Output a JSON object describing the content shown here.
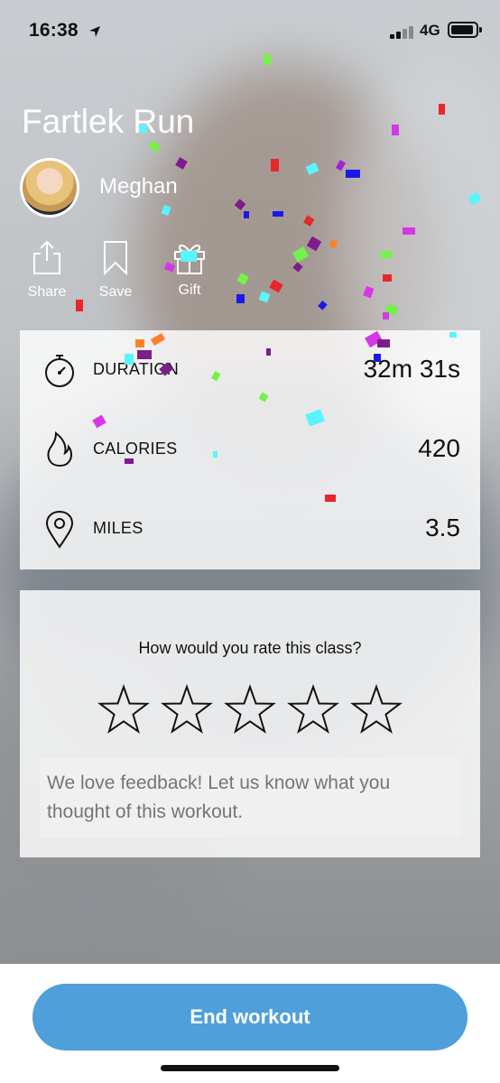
{
  "status_bar": {
    "time": "16:38",
    "network": "4G"
  },
  "workout": {
    "title": "Fartlek Run",
    "instructor": "Meghan"
  },
  "actions": [
    {
      "label": "Share",
      "icon": "share-icon"
    },
    {
      "label": "Save",
      "icon": "bookmark-icon"
    },
    {
      "label": "Gift",
      "icon": "gift-icon"
    }
  ],
  "stats": [
    {
      "label": "DURATION",
      "value": "32m 31s",
      "icon": "stopwatch-icon"
    },
    {
      "label": "CALORIES",
      "value": "420",
      "icon": "flame-icon"
    },
    {
      "label": "MILES",
      "value": "3.5",
      "icon": "location-pin-icon"
    }
  ],
  "rating": {
    "question": "How would you rate this class?",
    "max_stars": 5,
    "selected": 0,
    "feedback_placeholder": "We love feedback! Let us know what you thought of this workout."
  },
  "end_button": {
    "label": "End workout"
  },
  "colors": {
    "accent": "#4f9fda",
    "confetti": [
      "#e8262b",
      "#7f1c8c",
      "#58f5ff",
      "#74f24a",
      "#d638e6",
      "#1a1ae6",
      "#ff7f27",
      "#a81fd6"
    ]
  }
}
